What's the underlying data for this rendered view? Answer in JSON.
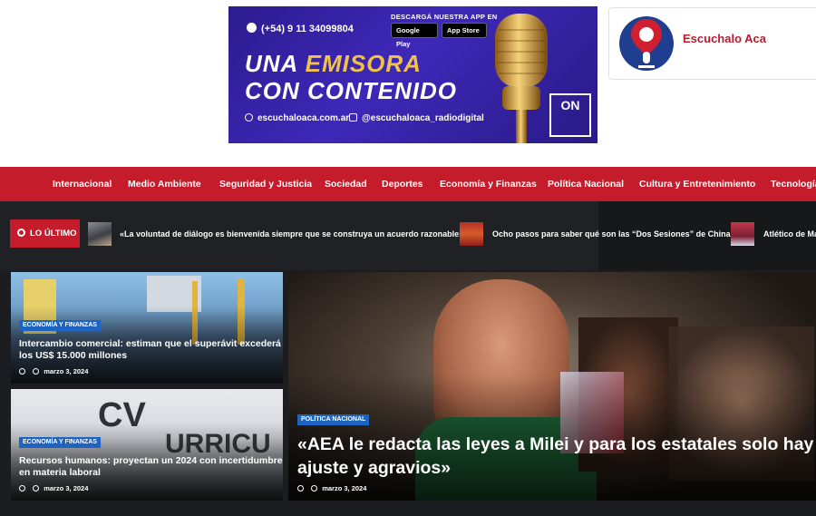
{
  "banner": {
    "phone": "(+54) 9 11 34099804",
    "app_label": "DESCARGÁ NUESTRA APP EN",
    "google_play": "Google Play",
    "app_store": "App Store",
    "tagline_1a": "UNA",
    "tagline_1b": "EMISORA",
    "tagline_2": "CON CONTENIDO",
    "website": "escuchaloaca.com.ar",
    "instagram": "@escuchaloaca_radiodigital",
    "on_label": "ON"
  },
  "site": {
    "name": "Escuchalo Aca"
  },
  "nav": {
    "items": [
      "Internacional",
      "Medio Ambiente",
      "Seguridad y Justicia",
      "Sociedad",
      "Deportes",
      "Economía y Finanzas",
      "Política Nacional",
      "Cultura y Entretenimiento",
      "Tecnología"
    ]
  },
  "ticker": {
    "label": "LO ÚLTIMO",
    "items": [
      "«La voluntad de diálogo es bienvenida siempre que se construya un acuerdo razonable»",
      "Ocho pasos para saber qué son las “Dos Sesiones” de China",
      "Atlético de Ma"
    ]
  },
  "cards": [
    {
      "category": "ECONOMÍA Y FINANZAS",
      "title_line1": "Intercambio comercial: estiman que el superávit excederá",
      "title_line2": "los US$ 15.000 millones",
      "date": "marzo 3, 2024"
    },
    {
      "category": "ECONOMÍA Y FINANZAS",
      "title_line1": "Recursos humanos: proyectan un 2024 con incertidumbre",
      "title_line2": "en materia laboral",
      "date": "marzo 3, 2024"
    }
  ],
  "hero": {
    "category": "POLÍTICA NACIONAL",
    "title_line1": "«AEA le redacta las leyes a Milei y para los estatales solo hay",
    "title_line2": "ajuste y agravios»",
    "date": "marzo 3, 2024"
  },
  "colors": {
    "brand_red": "#c41c2b",
    "category_blue": "#1f63c0",
    "dark_bg": "#1c1d20"
  }
}
